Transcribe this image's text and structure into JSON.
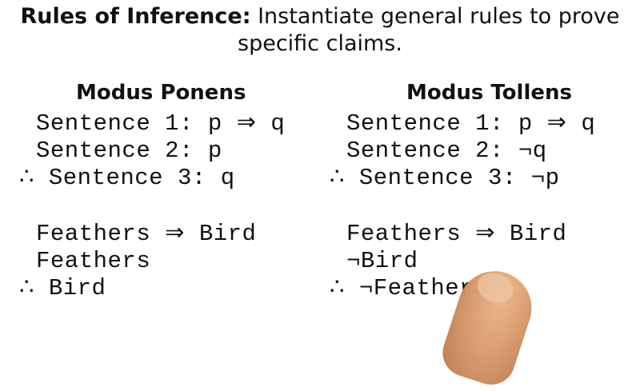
{
  "title": {
    "bold": "Rules of Inference:",
    "rest": " Instantiate general rules to prove",
    "line2": "specific claims."
  },
  "modus_ponens": {
    "heading": "Modus Ponens",
    "abstract": [
      "Sentence 1: p ⇒ q",
      "Sentence 2: p",
      "∴ Sentence 3: q"
    ],
    "example": [
      "Feathers ⇒ Bird",
      "Feathers",
      "∴ Bird"
    ]
  },
  "modus_tollens": {
    "heading": "Modus Tollens",
    "abstract": [
      "Sentence 1: p ⇒ q",
      "Sentence 2: ¬q",
      "∴ Sentence 3: ¬p"
    ],
    "example": [
      "Feathers ⇒ Bird",
      "¬Bird",
      "∴ ¬Feathers"
    ]
  }
}
